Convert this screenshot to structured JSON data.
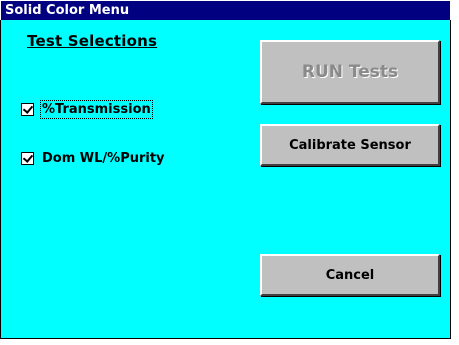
{
  "window": {
    "title": "Solid Color Menu"
  },
  "tests": {
    "heading": "Test Selections",
    "items": [
      {
        "label": "%Transmission",
        "checked": true
      },
      {
        "label": "Dom WL/%Purity",
        "checked": true
      }
    ]
  },
  "buttons": {
    "run": {
      "label": "RUN Tests",
      "enabled": false
    },
    "calibrate": {
      "label": "Calibrate Sensor",
      "enabled": true
    },
    "cancel": {
      "label": "Cancel",
      "enabled": true
    }
  },
  "colors": {
    "title_bar": "#000080",
    "client_background": "#00ffff",
    "button_face": "#c0c0c0"
  }
}
